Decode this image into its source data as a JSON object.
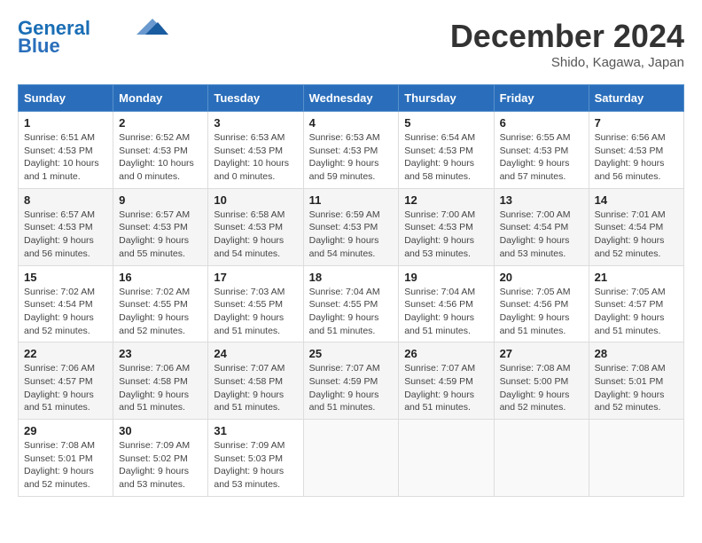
{
  "header": {
    "logo_line1": "General",
    "logo_line2": "Blue",
    "month": "December 2024",
    "location": "Shido, Kagawa, Japan"
  },
  "weekdays": [
    "Sunday",
    "Monday",
    "Tuesday",
    "Wednesday",
    "Thursday",
    "Friday",
    "Saturday"
  ],
  "weeks": [
    [
      {
        "day": "1",
        "sunrise": "6:51 AM",
        "sunset": "4:53 PM",
        "daylight": "10 hours and 1 minute."
      },
      {
        "day": "2",
        "sunrise": "6:52 AM",
        "sunset": "4:53 PM",
        "daylight": "10 hours and 0 minutes."
      },
      {
        "day": "3",
        "sunrise": "6:53 AM",
        "sunset": "4:53 PM",
        "daylight": "10 hours and 0 minutes."
      },
      {
        "day": "4",
        "sunrise": "6:53 AM",
        "sunset": "4:53 PM",
        "daylight": "9 hours and 59 minutes."
      },
      {
        "day": "5",
        "sunrise": "6:54 AM",
        "sunset": "4:53 PM",
        "daylight": "9 hours and 58 minutes."
      },
      {
        "day": "6",
        "sunrise": "6:55 AM",
        "sunset": "4:53 PM",
        "daylight": "9 hours and 57 minutes."
      },
      {
        "day": "7",
        "sunrise": "6:56 AM",
        "sunset": "4:53 PM",
        "daylight": "9 hours and 56 minutes."
      }
    ],
    [
      {
        "day": "8",
        "sunrise": "6:57 AM",
        "sunset": "4:53 PM",
        "daylight": "9 hours and 56 minutes."
      },
      {
        "day": "9",
        "sunrise": "6:57 AM",
        "sunset": "4:53 PM",
        "daylight": "9 hours and 55 minutes."
      },
      {
        "day": "10",
        "sunrise": "6:58 AM",
        "sunset": "4:53 PM",
        "daylight": "9 hours and 54 minutes."
      },
      {
        "day": "11",
        "sunrise": "6:59 AM",
        "sunset": "4:53 PM",
        "daylight": "9 hours and 54 minutes."
      },
      {
        "day": "12",
        "sunrise": "7:00 AM",
        "sunset": "4:53 PM",
        "daylight": "9 hours and 53 minutes."
      },
      {
        "day": "13",
        "sunrise": "7:00 AM",
        "sunset": "4:54 PM",
        "daylight": "9 hours and 53 minutes."
      },
      {
        "day": "14",
        "sunrise": "7:01 AM",
        "sunset": "4:54 PM",
        "daylight": "9 hours and 52 minutes."
      }
    ],
    [
      {
        "day": "15",
        "sunrise": "7:02 AM",
        "sunset": "4:54 PM",
        "daylight": "9 hours and 52 minutes."
      },
      {
        "day": "16",
        "sunrise": "7:02 AM",
        "sunset": "4:55 PM",
        "daylight": "9 hours and 52 minutes."
      },
      {
        "day": "17",
        "sunrise": "7:03 AM",
        "sunset": "4:55 PM",
        "daylight": "9 hours and 51 minutes."
      },
      {
        "day": "18",
        "sunrise": "7:04 AM",
        "sunset": "4:55 PM",
        "daylight": "9 hours and 51 minutes."
      },
      {
        "day": "19",
        "sunrise": "7:04 AM",
        "sunset": "4:56 PM",
        "daylight": "9 hours and 51 minutes."
      },
      {
        "day": "20",
        "sunrise": "7:05 AM",
        "sunset": "4:56 PM",
        "daylight": "9 hours and 51 minutes."
      },
      {
        "day": "21",
        "sunrise": "7:05 AM",
        "sunset": "4:57 PM",
        "daylight": "9 hours and 51 minutes."
      }
    ],
    [
      {
        "day": "22",
        "sunrise": "7:06 AM",
        "sunset": "4:57 PM",
        "daylight": "9 hours and 51 minutes."
      },
      {
        "day": "23",
        "sunrise": "7:06 AM",
        "sunset": "4:58 PM",
        "daylight": "9 hours and 51 minutes."
      },
      {
        "day": "24",
        "sunrise": "7:07 AM",
        "sunset": "4:58 PM",
        "daylight": "9 hours and 51 minutes."
      },
      {
        "day": "25",
        "sunrise": "7:07 AM",
        "sunset": "4:59 PM",
        "daylight": "9 hours and 51 minutes."
      },
      {
        "day": "26",
        "sunrise": "7:07 AM",
        "sunset": "4:59 PM",
        "daylight": "9 hours and 51 minutes."
      },
      {
        "day": "27",
        "sunrise": "7:08 AM",
        "sunset": "5:00 PM",
        "daylight": "9 hours and 52 minutes."
      },
      {
        "day": "28",
        "sunrise": "7:08 AM",
        "sunset": "5:01 PM",
        "daylight": "9 hours and 52 minutes."
      }
    ],
    [
      {
        "day": "29",
        "sunrise": "7:08 AM",
        "sunset": "5:01 PM",
        "daylight": "9 hours and 52 minutes."
      },
      {
        "day": "30",
        "sunrise": "7:09 AM",
        "sunset": "5:02 PM",
        "daylight": "9 hours and 53 minutes."
      },
      {
        "day": "31",
        "sunrise": "7:09 AM",
        "sunset": "5:03 PM",
        "daylight": "9 hours and 53 minutes."
      },
      null,
      null,
      null,
      null
    ]
  ]
}
